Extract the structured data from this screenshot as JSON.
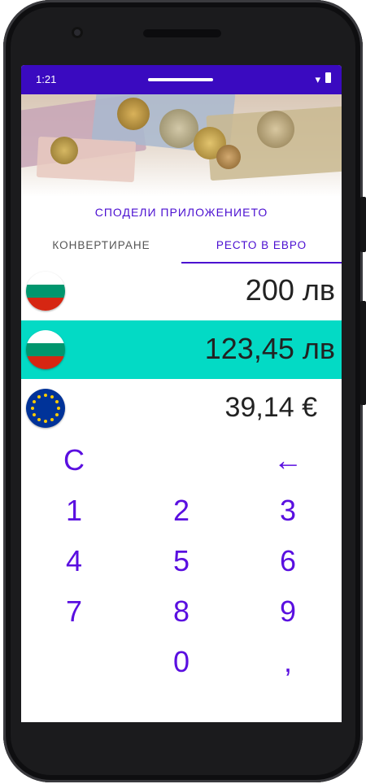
{
  "status": {
    "time": "1:21",
    "wifi_icon": "wifi-icon",
    "battery_icon": "battery-icon"
  },
  "share_label": "СПОДЕЛИ ПРИЛОЖЕНИЕТО",
  "tabs": [
    {
      "label": "КОНВЕРТИРАНЕ",
      "selected": false
    },
    {
      "label": "РЕСТО В ЕВРО",
      "selected": true
    }
  ],
  "rows": [
    {
      "flag": "bulgaria-flag-icon",
      "amount": "200 лв",
      "highlighted": false
    },
    {
      "flag": "bulgaria-flag-icon",
      "amount": "123,45 лв",
      "highlighted": true
    },
    {
      "flag": "eu-flag-icon",
      "amount": "39,14 €",
      "highlighted": false
    }
  ],
  "keypad": {
    "clear": "C",
    "backspace": "←",
    "k1": "1",
    "k2": "2",
    "k3": "3",
    "k4": "4",
    "k5": "5",
    "k6": "6",
    "k7": "7",
    "k8": "8",
    "k9": "9",
    "k0": "0",
    "comma": ","
  },
  "colors": {
    "status_bar": "#3a0ac0",
    "accent": "#4b0fd1",
    "highlight": "#03dac5",
    "key_text": "#5a0fe0"
  }
}
